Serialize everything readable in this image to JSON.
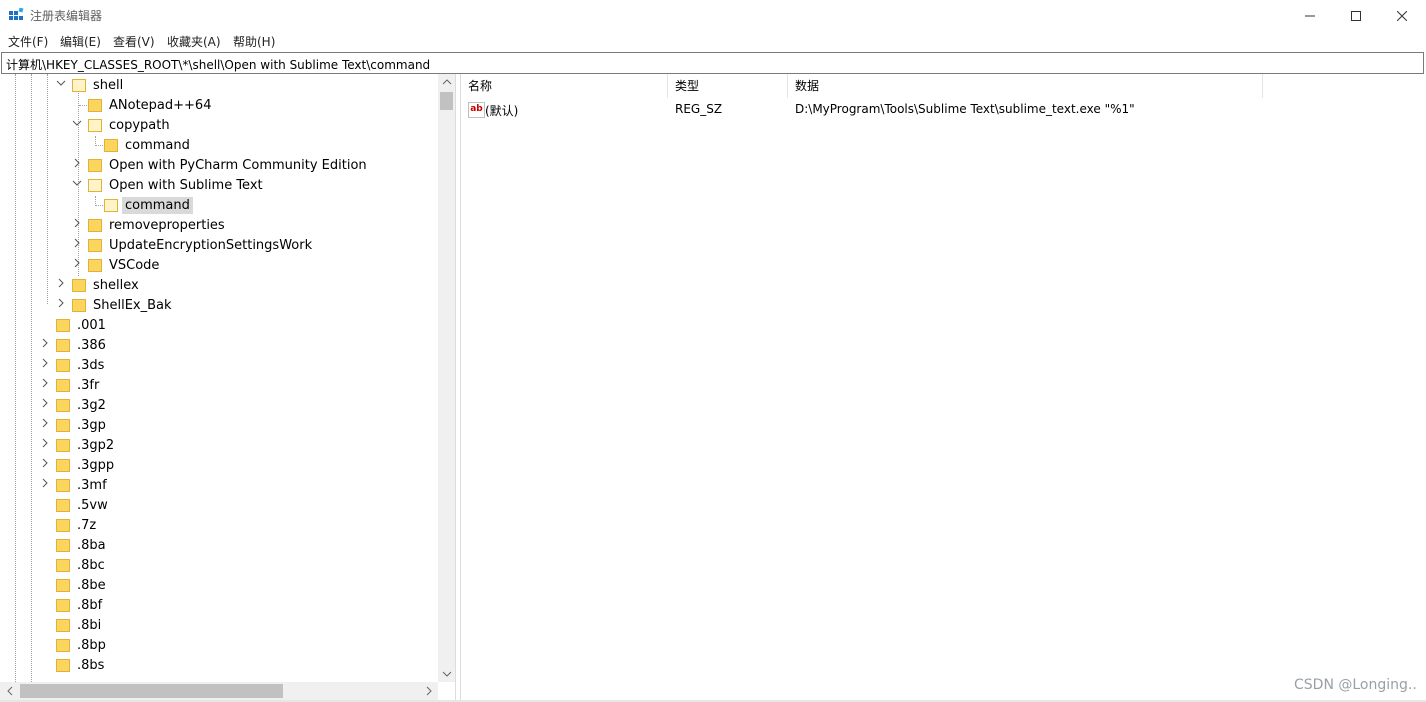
{
  "window": {
    "title": "注册表编辑器"
  },
  "menu": [
    {
      "label": "文件(F)"
    },
    {
      "label": "编辑(E)"
    },
    {
      "label": "查看(V)"
    },
    {
      "label": "收藏夹(A)"
    },
    {
      "label": "帮助(H)"
    }
  ],
  "address": "计算机\\HKEY_CLASSES_ROOT\\*\\shell\\Open with Sublime Text\\command",
  "tree": [
    {
      "label": "shell",
      "level": 2,
      "expanded": true
    },
    {
      "label": "ANotepad++64",
      "level": 3
    },
    {
      "label": "copypath",
      "level": 3,
      "expanded": true
    },
    {
      "label": "command",
      "level": 4
    },
    {
      "label": "Open with PyCharm Community Edition",
      "level": 3,
      "collapsed": true
    },
    {
      "label": "Open with Sublime Text",
      "level": 3,
      "expanded": true
    },
    {
      "label": "command",
      "level": 4,
      "selected": true
    },
    {
      "label": "removeproperties",
      "level": 3,
      "collapsed": true
    },
    {
      "label": "UpdateEncryptionSettingsWork",
      "level": 3,
      "collapsed": true
    },
    {
      "label": "VSCode",
      "level": 3,
      "collapsed": true
    },
    {
      "label": "shellex",
      "level": 2,
      "collapsed": true
    },
    {
      "label": "ShellEx_Bak",
      "level": 2,
      "collapsed": true
    },
    {
      "label": ".001",
      "level": 1
    },
    {
      "label": ".386",
      "level": 1,
      "collapsed": true
    },
    {
      "label": ".3ds",
      "level": 1,
      "collapsed": true
    },
    {
      "label": ".3fr",
      "level": 1,
      "collapsed": true
    },
    {
      "label": ".3g2",
      "level": 1,
      "collapsed": true
    },
    {
      "label": ".3gp",
      "level": 1,
      "collapsed": true
    },
    {
      "label": ".3gp2",
      "level": 1,
      "collapsed": true
    },
    {
      "label": ".3gpp",
      "level": 1,
      "collapsed": true
    },
    {
      "label": ".3mf",
      "level": 1,
      "collapsed": true
    },
    {
      "label": ".5vw",
      "level": 1
    },
    {
      "label": ".7z",
      "level": 1
    },
    {
      "label": ".8ba",
      "level": 1
    },
    {
      "label": ".8bc",
      "level": 1
    },
    {
      "label": ".8be",
      "level": 1
    },
    {
      "label": ".8bf",
      "level": 1
    },
    {
      "label": ".8bi",
      "level": 1
    },
    {
      "label": ".8bp",
      "level": 1
    },
    {
      "label": ".8bs",
      "level": 1
    }
  ],
  "columns": {
    "name": "名称",
    "type": "类型",
    "data": "数据"
  },
  "values": [
    {
      "name": "(默认)",
      "type": "REG_SZ",
      "data": "D:\\MyProgram\\Tools\\Sublime Text\\sublime_text.exe \"%1\""
    }
  ],
  "watermark": "CSDN @Longing.."
}
